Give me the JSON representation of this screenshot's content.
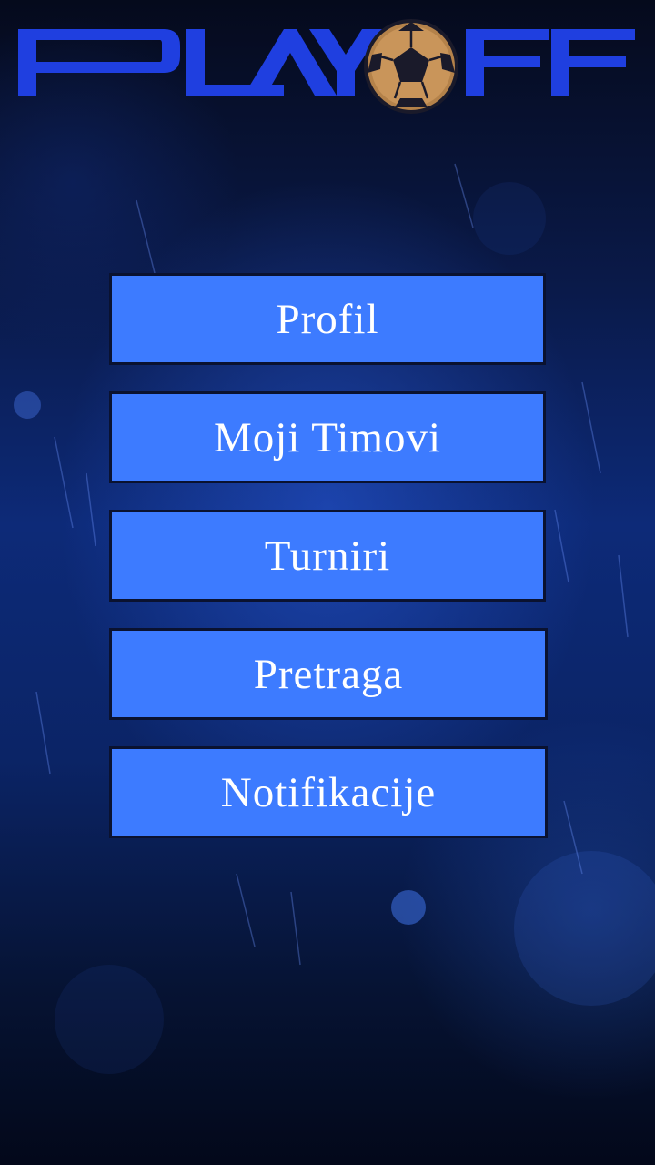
{
  "app": {
    "logo_text_left": "PLAY",
    "logo_text_right": "FF",
    "logo_icon": "soccer-ball-icon"
  },
  "menu": {
    "items": [
      {
        "label": "Profil"
      },
      {
        "label": "Moji Timovi"
      },
      {
        "label": "Turniri"
      },
      {
        "label": "Pretraga"
      },
      {
        "label": "Notifikacije"
      }
    ]
  },
  "colors": {
    "button_fill": "#3d7bff",
    "button_border": "#0a1230",
    "logo_blue": "#1f3fe0",
    "ball_bronze": "#b4824a",
    "background_blue": "#0d2a78"
  }
}
